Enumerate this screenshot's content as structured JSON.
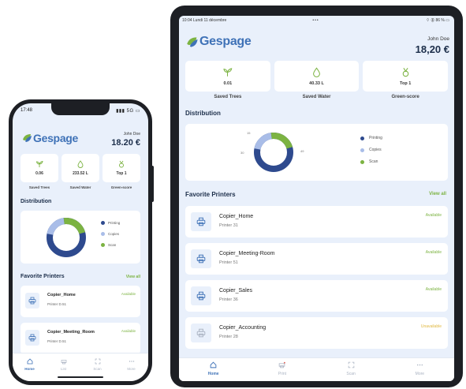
{
  "colors": {
    "primary": "#3f72b7",
    "accent_green": "#7cb342",
    "unavailable": "#e0b840",
    "background": "#e9f0fb",
    "printing": "#2e4a8e",
    "copies": "#a9bde8",
    "scan": "#7cb342"
  },
  "brand": {
    "name": "Gespage"
  },
  "phone": {
    "status": {
      "time": "17:48",
      "signal": "▮▮▮ 5G ▭"
    },
    "user": {
      "name": "John Doe",
      "amount": "18.20 €"
    },
    "metrics": [
      {
        "value": "0.06",
        "label": "Saved Trees",
        "icon": "sprout-icon"
      },
      {
        "value": "233.52 L",
        "label": "Saved Water",
        "icon": "water-drop-icon"
      },
      {
        "value": "Top 1",
        "label": "Green-score",
        "icon": "medal-icon"
      }
    ],
    "distribution_title": "Distribution",
    "legend": [
      "Printing",
      "Copies",
      "Scan"
    ],
    "favorites_title": "Favorite Printers",
    "view_all": "View all",
    "printers": [
      {
        "name": "Copier_Home",
        "sub": "Printer D.51",
        "status": "Available"
      },
      {
        "name": "Copier_Meeting_Room",
        "sub": "Printer D.51",
        "status": "Available"
      }
    ],
    "tabs": [
      "Home",
      "List",
      "Scan",
      "More"
    ]
  },
  "tablet": {
    "status": {
      "left": "10:04   Lundi 11 décembre",
      "middle": "•••",
      "right": "⌔ ◉ 86 % ▭"
    },
    "user": {
      "name": "John Doe",
      "amount": "18,20 €"
    },
    "metrics": [
      {
        "value": "0.01",
        "label": "Saved Trees",
        "icon": "sprout-icon"
      },
      {
        "value": "40.33 L",
        "label": "Saved Water",
        "icon": "water-drop-icon"
      },
      {
        "value": "Top 1",
        "label": "Green-score",
        "icon": "medal-icon"
      }
    ],
    "distribution_title": "Distribution",
    "chart_labels": [
      "15",
      "30",
      "49"
    ],
    "legend": [
      "Printing",
      "Copies",
      "Scan"
    ],
    "favorites_title": "Favorite Printers",
    "view_all": "View all",
    "printers": [
      {
        "name": "Copier_Home",
        "sub": "Printer 31",
        "status": "Available",
        "status_color": "#7cb342"
      },
      {
        "name": "Copier_Meeting-Room",
        "sub": "Printer 51",
        "status": "Available",
        "status_color": "#7cb342"
      },
      {
        "name": "Copier_Sales",
        "sub": "Printer 36",
        "status": "Available",
        "status_color": "#7cb342"
      },
      {
        "name": "Copier_Accounting",
        "sub": "Printer 28",
        "status": "Unavailable",
        "status_color": "#e0b840"
      }
    ],
    "tabs": [
      "Home",
      "Print",
      "Scan",
      "More"
    ]
  },
  "chart_data": {
    "type": "pie",
    "title": "Distribution",
    "categories": [
      "Printing",
      "Copies",
      "Scan"
    ],
    "values": [
      49,
      30,
      15
    ]
  }
}
